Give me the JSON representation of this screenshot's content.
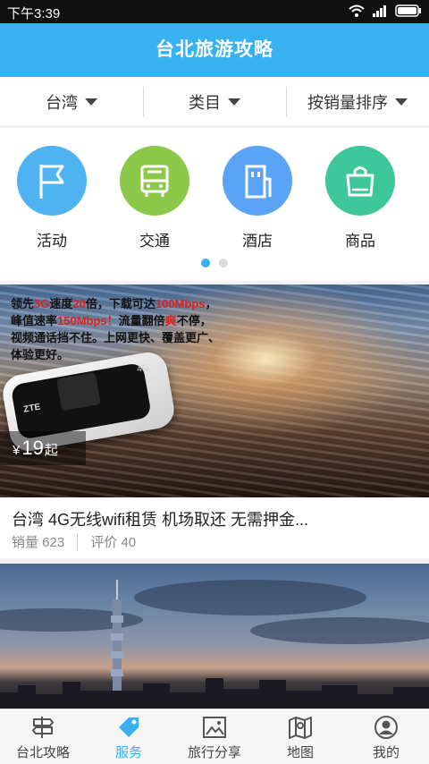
{
  "status_bar": {
    "time": "下午3:39",
    "icons": [
      "wifi-icon",
      "signal-icon",
      "battery-icon"
    ]
  },
  "header": {
    "title": "台北旅游攻略"
  },
  "filters": [
    {
      "label": "台湾",
      "icon": "caret-down-icon"
    },
    {
      "label": "类目",
      "icon": "caret-down-icon"
    },
    {
      "label": "按销量排序",
      "icon": "caret-down-icon"
    }
  ],
  "categories": [
    {
      "label": "活动",
      "icon": "flag-icon",
      "color": "#4fb3f2"
    },
    {
      "label": "交通",
      "icon": "bus-icon",
      "color": "#8cc94a"
    },
    {
      "label": "酒店",
      "icon": "building-icon",
      "color": "#5aa3f5"
    },
    {
      "label": "商品",
      "icon": "shopping-bag-icon",
      "color": "#3ec79b"
    }
  ],
  "carousel": {
    "pages": 2,
    "active": 0
  },
  "products": [
    {
      "banner_text": {
        "l1a": "领先",
        "l1b": "3G",
        "l1c": "速度",
        "l1d": "20",
        "l1e": "倍，下载可达",
        "l1f": "100Mbps",
        "l1g": "，",
        "l2a": "峰值速率",
        "l2b": "150Mbps！",
        "l2c": "流量翻倍",
        "l2d": "爽",
        "l2e": "不停，",
        "l3": "视频通话挡不住。上网更快、覆盖更广、",
        "l4": "体验更好。"
      },
      "device_brand": "ZTE",
      "device_label": "4G",
      "price": {
        "currency": "¥",
        "value": "19",
        "suffix": "起"
      },
      "title": "台湾 4G无线wifi租赁 机场取还 无需押金...",
      "sales": "销量 623",
      "reviews": "评价 40"
    }
  ],
  "bottom_nav": [
    {
      "label": "台北攻略",
      "icon": "signpost-icon",
      "active": false
    },
    {
      "label": "服务",
      "icon": "tag-icon",
      "active": true
    },
    {
      "label": "旅行分享",
      "icon": "image-icon",
      "active": false
    },
    {
      "label": "地图",
      "icon": "map-icon",
      "active": false
    },
    {
      "label": "我的",
      "icon": "user-icon",
      "active": false
    }
  ],
  "colors": {
    "primary": "#37b1f0",
    "price_red": "#e02020"
  }
}
